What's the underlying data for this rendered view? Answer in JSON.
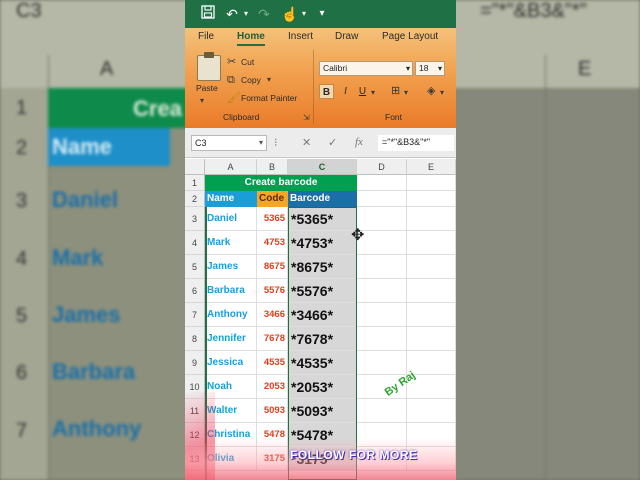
{
  "background": {
    "cell_ref": "C3",
    "formula": "=\"*\"&B3&\"*\"",
    "columns": [
      "A",
      "E"
    ],
    "title": "Crea",
    "header": "Name",
    "rows": [
      "1",
      "2",
      "3",
      "4",
      "5",
      "6",
      "7"
    ],
    "names": [
      "Daniel",
      "Mark",
      "James",
      "Barbara",
      "Anthony"
    ]
  },
  "ribbon": {
    "tabs": [
      "File",
      "Home",
      "Insert",
      "Draw",
      "Page Layout"
    ],
    "active_tab": "Home",
    "clipboard": {
      "paste": "Paste",
      "cut": "Cut",
      "copy": "Copy",
      "format_painter": "Format Painter",
      "group_label": "Clipboard"
    },
    "font": {
      "name": "Calibri",
      "size": "18",
      "bold": "B",
      "italic": "I",
      "underline": "U",
      "group_label": "Font"
    }
  },
  "formula_bar": {
    "name_box": "C3",
    "formula": "=\"*\"&B3&\"*\""
  },
  "sheet": {
    "columns": [
      "A",
      "B",
      "C",
      "D",
      "E"
    ],
    "selected_column": "C",
    "row_numbers": [
      "1",
      "2",
      "3",
      "4",
      "5",
      "6",
      "7",
      "8",
      "9",
      "10",
      "11",
      "12",
      "13"
    ],
    "title": "Create barcode",
    "headers": {
      "name": "Name",
      "code": "Code",
      "barcode": "Barcode"
    },
    "rows": [
      {
        "name": "Daniel",
        "code": "5365",
        "barcode": "*5365*"
      },
      {
        "name": "Mark",
        "code": "4753",
        "barcode": "*4753*"
      },
      {
        "name": "James",
        "code": "8675",
        "barcode": "*8675*"
      },
      {
        "name": "Barbara",
        "code": "5576",
        "barcode": "*5576*"
      },
      {
        "name": "Anthony",
        "code": "3466",
        "barcode": "*3466*"
      },
      {
        "name": "Jennifer",
        "code": "7678",
        "barcode": "*7678*"
      },
      {
        "name": "Jessica",
        "code": "4535",
        "barcode": "*4535*"
      },
      {
        "name": "Noah",
        "code": "2053",
        "barcode": "*2053*"
      },
      {
        "name": "Walter",
        "code": "5093",
        "barcode": "*5093*"
      },
      {
        "name": "Christina",
        "code": "5478",
        "barcode": "*5478*"
      },
      {
        "name": "Olivia",
        "code": "3175",
        "barcode": "*3175*"
      }
    ]
  },
  "overlay": {
    "watermark": "By Raj",
    "follow": "FOLLOW FOR MORE"
  },
  "colors": {
    "excel_green": "#1f7145",
    "title_fill": "#00a050",
    "name_header_fill": "#1a9ed8",
    "code_header_fill": "#f5a623",
    "barcode_header_fill": "#1a6fa8",
    "name_text": "#1a9ed8",
    "code_text": "#e43c1a"
  }
}
